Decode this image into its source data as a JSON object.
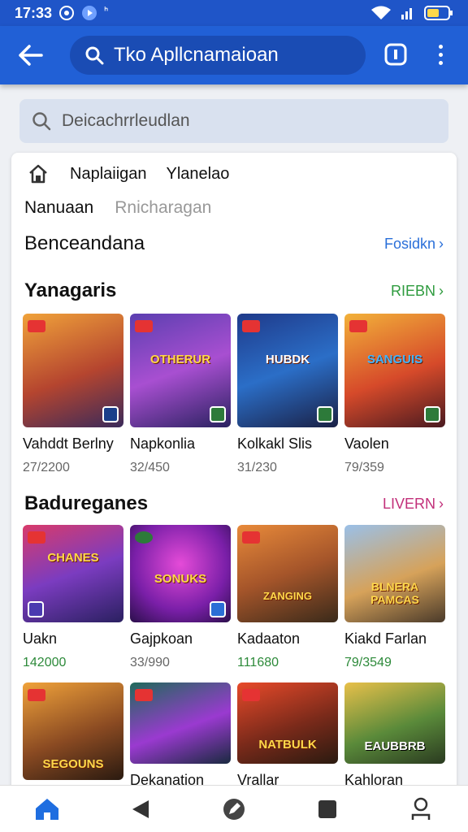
{
  "status_bar": {
    "time": "17:33",
    "extra": "ᑋ"
  },
  "app_bar": {
    "search_text": "Tko Apllcnamaioan"
  },
  "search": {
    "placeholder": "Deicachrrleudlan"
  },
  "nav_row": {
    "item1": "Naplaiigan",
    "item2": "Ylanelao"
  },
  "tabs_row": {
    "active": "Nanuaan",
    "inactive": "Rnicharagan"
  },
  "sections": [
    {
      "title": "Benceandana",
      "link": "Fosidkn"
    },
    {
      "title": "Yanagaris",
      "link": "RIEBN"
    },
    {
      "title": "Badureganes",
      "link": "LIVERN"
    }
  ],
  "row1_items": [
    {
      "name": "Vahddt Berlny",
      "num": "27/2200"
    },
    {
      "name": "Napkonlia",
      "num": "32/450"
    },
    {
      "name": "Kolkakl Slis",
      "num": "31/230"
    },
    {
      "name": "Vaolen",
      "num": "79/359"
    }
  ],
  "row1_logos": [
    "",
    "OTHERUR",
    "HUBDK",
    "SANGUIS"
  ],
  "row2_items": [
    {
      "name": "Uakn",
      "num": "142000"
    },
    {
      "name": "Gajpkoan",
      "num": "33/990"
    },
    {
      "name": "Kadaaton",
      "num": "111680"
    },
    {
      "name": "Kiakd Farlan",
      "num": "79/3549"
    }
  ],
  "row2_logos": [
    "CHANES",
    "SONUKS",
    "ZANGING",
    "BLNERA PAMCAS"
  ],
  "row3_items": [
    {
      "name": "",
      "num": ""
    },
    {
      "name": "Dekanation",
      "num": ""
    },
    {
      "name": "Vrallar",
      "num": ""
    },
    {
      "name": "Kahloran",
      "num": ""
    }
  ],
  "row3_logos": [
    "SEGOUNS",
    "",
    "NATBULK",
    "EAUBBRB"
  ],
  "colors": {
    "appbar": "#2160d6",
    "link_blue": "#2a6fd9",
    "link_green": "#2e9b3e",
    "link_pink": "#c2307a"
  },
  "icons": [
    "back-arrow-icon",
    "search-icon",
    "page-icon",
    "more-vert-icon",
    "home-icon",
    "back-triangle-icon",
    "edit-icon",
    "square-icon",
    "profile-icon"
  ]
}
